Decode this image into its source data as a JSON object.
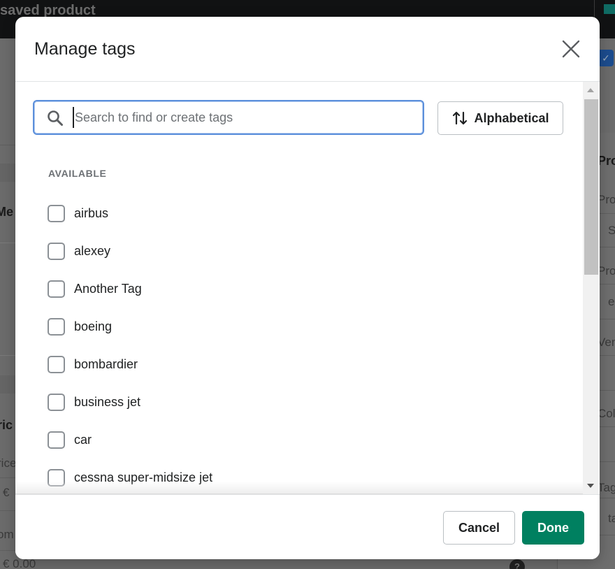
{
  "background": {
    "header_title": "saved product",
    "left_fragments": [
      "Me",
      "ric",
      "rice",
      "€",
      "om",
      "€  0.00"
    ],
    "right_fragments": [
      "Pro",
      "Pro",
      "S",
      "Pro",
      "e",
      "Ven",
      "Col",
      "Tag",
      "ta"
    ]
  },
  "modal": {
    "title": "Manage tags",
    "close_label": "Close",
    "search": {
      "value": "",
      "placeholder": "Search to find or create tags"
    },
    "sort": {
      "label": "Alphabetical",
      "icon": "sort-arrows-icon"
    },
    "section_label": "AVAILABLE",
    "tags": [
      {
        "label": "airbus",
        "checked": false
      },
      {
        "label": "alexey",
        "checked": false
      },
      {
        "label": "Another Tag",
        "checked": false
      },
      {
        "label": "boeing",
        "checked": false
      },
      {
        "label": "bombardier",
        "checked": false
      },
      {
        "label": "business jet",
        "checked": false
      },
      {
        "label": "car",
        "checked": false
      },
      {
        "label": "cessna super-midsize jet",
        "checked": false
      }
    ],
    "footer": {
      "cancel_label": "Cancel",
      "done_label": "Done"
    }
  },
  "colors": {
    "primary": "#008060",
    "focus_ring": "#5b8fdb",
    "overlay": "#6b6b6b"
  }
}
